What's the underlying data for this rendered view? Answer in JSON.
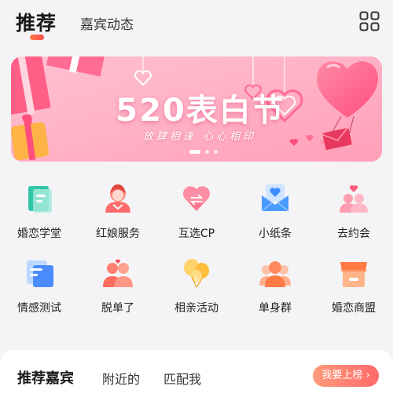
{
  "header": {
    "tabs": [
      {
        "label": "推荐",
        "active": true
      },
      {
        "label": "嘉宾动态",
        "active": false
      }
    ],
    "menu_icon": "grid-icon"
  },
  "banner": {
    "title": "520表白节",
    "subtitle": "放肆相逢 心心相印",
    "slides": 3,
    "active_slide": 0
  },
  "features": [
    {
      "label": "婚恋学堂",
      "icon": "book-icon"
    },
    {
      "label": "红娘服务",
      "icon": "matchmaker-icon"
    },
    {
      "label": "互选CP",
      "icon": "heart-swap-icon"
    },
    {
      "label": "小纸条",
      "icon": "envelope-icon"
    },
    {
      "label": "去约会",
      "icon": "date-icon"
    },
    {
      "label": "情感测试",
      "icon": "test-icon"
    },
    {
      "label": "脱单了",
      "icon": "couple-icon"
    },
    {
      "label": "相亲活动",
      "icon": "balloon-icon"
    },
    {
      "label": "单身群",
      "icon": "group-icon"
    },
    {
      "label": "婚恋商盟",
      "icon": "shop-icon"
    }
  ],
  "bottom": {
    "tabs": [
      "推荐嘉宾",
      "附近的",
      "匹配我"
    ],
    "rank_button": "我要上榜",
    "rank_arrow": "›"
  },
  "colors": {
    "accent": "#ff5a4f",
    "banner_bg": "#ffb3c6"
  }
}
